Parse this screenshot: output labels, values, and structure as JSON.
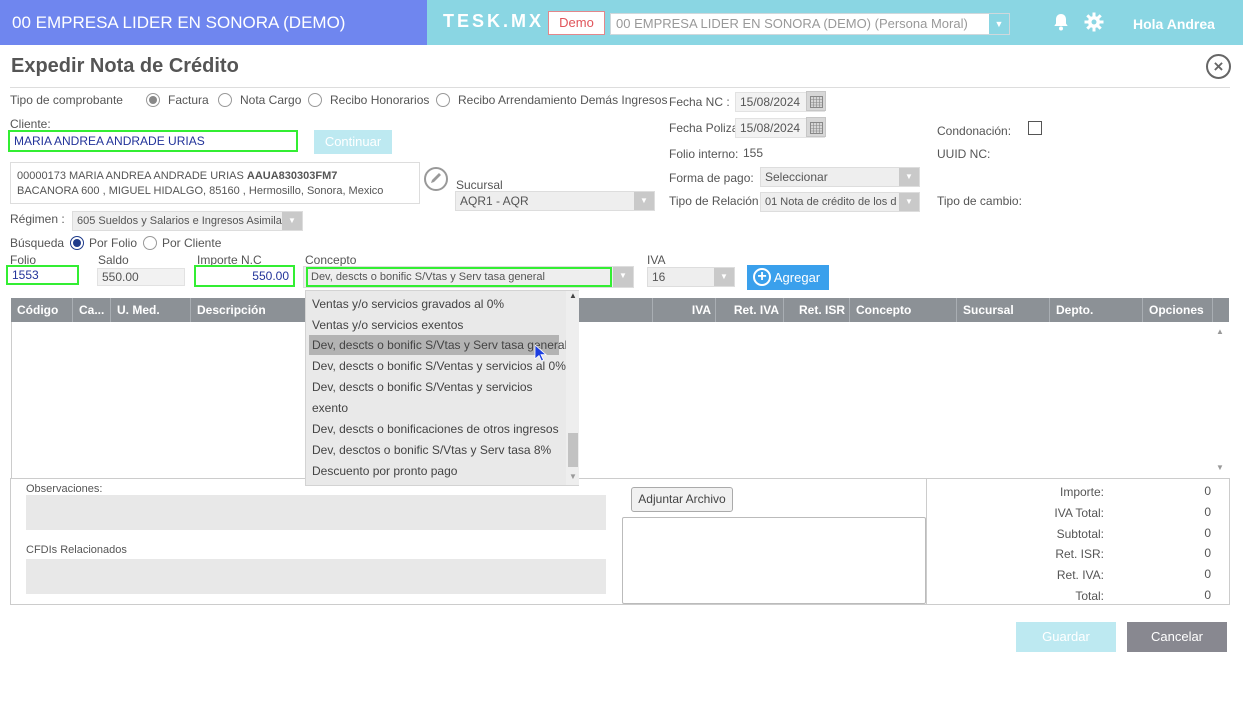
{
  "header": {
    "company_title": "00 EMPRESA LIDER EN SONORA (DEMO)",
    "brand": "TESK.MX",
    "demo_label": "Demo",
    "company_select": "00 EMPRESA LIDER EN SONORA (DEMO) (Persona Moral)",
    "greeting": "Hola Andrea"
  },
  "page": {
    "title": "Expedir Nota de Crédito",
    "close_icon": "close-icon"
  },
  "form": {
    "tipo_comprobante_label": "Tipo de comprobante",
    "tipo_options": [
      "Factura",
      "Nota Cargo",
      "Recibo Honorarios",
      "Recibo Arrendamiento Demás Ingresos"
    ],
    "tipo_selected": "Factura",
    "cliente_label": "Cliente:",
    "cliente_value": "MARIA ANDREA ANDRADE URIAS",
    "continuar_label": "Continuar",
    "cliente_info_line1": "00000173 MARIA ANDREA ANDRADE URIAS",
    "cliente_rfc": "AAUA830303FM7",
    "cliente_info_line2": "BACANORA 600 , MIGUEL HIDALGO, 85160 , Hermosillo, Sonora, Mexico",
    "sucursal_label": "Sucursal",
    "sucursal_value": "AQR1 - AQR",
    "regimen_label": "Régimen :",
    "regimen_value": "605 Sueldos y Salarios e Ingresos Asimila",
    "busqueda_label": "Búsqueda",
    "busqueda_options": [
      "Por Folio",
      "Por Cliente"
    ],
    "busqueda_selected": "Por Folio",
    "folio_label": "Folio",
    "folio_value": "1553",
    "saldo_label": "Saldo",
    "saldo_value": "550.00",
    "importe_label": "Importe N.C",
    "importe_value": "550.00",
    "concepto_label": "Concepto",
    "concepto_value": "Dev, descts o bonific S/Vtas y Serv tasa general",
    "iva_label": "IVA",
    "iva_value": "16",
    "agregar_label": "Agregar"
  },
  "right_panel": {
    "fecha_nc_label": "Fecha NC :",
    "fecha_nc_value": "15/08/2024",
    "fecha_poliza_label": "Fecha Poliza:",
    "fecha_poliza_value": "15/08/2024",
    "folio_interno_label": "Folio interno:",
    "folio_interno_value": "155",
    "forma_pago_label": "Forma de pago:",
    "forma_pago_value": "Seleccionar",
    "tipo_relacion_label": "Tipo de Relación :",
    "tipo_relacion_value": "01 Nota de crédito de los d",
    "condonacion_label": "Condonación:",
    "uuid_label": "UUID NC:",
    "tipo_cambio_label": "Tipo de cambio:"
  },
  "grid": {
    "columns": [
      "Código",
      "Ca...",
      "U. Med.",
      "Descripción",
      "IVA",
      "Ret. IVA",
      "Ret. ISR",
      "Concepto",
      "Sucursal",
      "Depto.",
      "Opciones"
    ]
  },
  "dropdown": {
    "items": [
      "Ventas y/o servicios gravados al 0%",
      "Ventas y/o servicios exentos",
      "Dev, descts o bonific S/Vtas y Serv tasa general",
      "Dev, descts o bonific S/Ventas y servicios al 0%",
      "Dev, descts o bonific S/Ventas y servicios",
      "exento",
      "Dev, descts o bonificaciones de otros ingresos",
      "Dev, desctos o bonific S/Vtas y Serv tasa 8%",
      "Descuento por pronto pago"
    ],
    "highlighted": "Dev, descts o bonific S/Vtas y Serv tasa general"
  },
  "bottom": {
    "observaciones_label": "Observaciones:",
    "cfdis_label": "CFDIs Relacionados",
    "adjuntar_label": "Adjuntar Archivo"
  },
  "totals": {
    "importe_label": "Importe:",
    "importe_value": "0",
    "iva_label": "IVA Total:",
    "iva_value": "0",
    "subtotal_label": "Subtotal:",
    "subtotal_value": "0",
    "ret_isr_label": "Ret. ISR:",
    "ret_isr_value": "0",
    "ret_iva_label": "Ret. IVA:",
    "ret_iva_value": "0",
    "total_label": "Total:",
    "total_value": "0"
  },
  "actions": {
    "guardar_label": "Guardar",
    "cancelar_label": "Cancelar"
  }
}
